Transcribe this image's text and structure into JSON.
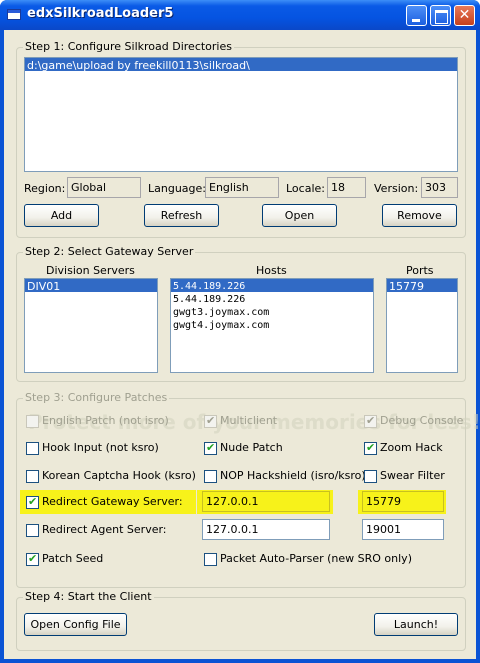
{
  "window": {
    "title": "edxSilkroadLoader5"
  },
  "step1": {
    "legend": "Step 1: Configure Silkroad Directories",
    "directories": [
      "d:\\game\\upload by freekill0113\\silkroad\\"
    ],
    "region_label": "Region:",
    "region_value": "Global",
    "language_label": "Language:",
    "language_value": "English",
    "locale_label": "Locale:",
    "locale_value": "18",
    "version_label": "Version:",
    "version_value": "303",
    "buttons": {
      "add": "Add",
      "refresh": "Refresh",
      "open": "Open",
      "remove": "Remove"
    }
  },
  "step2": {
    "legend": "Step 2: Select Gateway Server",
    "division_header": "Division Servers",
    "hosts_header": "Hosts",
    "ports_header": "Ports",
    "divisions": [
      "DIV01"
    ],
    "hosts": [
      "5.44.189.226",
      "5.44.189.226",
      "gwgt3.joymax.com",
      "gwgt4.joymax.com"
    ],
    "ports": [
      "15779"
    ]
  },
  "step3": {
    "legend": "Step 3: Configure Patches",
    "english_patch": "English Patch (not isro)",
    "multiclient": "Multiclient",
    "debug_console": "Debug Console",
    "hook_input": "Hook Input (not ksro)",
    "nude_patch": "Nude Patch",
    "zoom_hack": "Zoom Hack",
    "korean_captcha": "Korean Captcha Hook (ksro)",
    "nop_hackshield": "NOP Hackshield (isro/ksro)",
    "swear_filter": "Swear Filter",
    "redirect_gateway": "Redirect Gateway Server:",
    "gateway_ip": "127.0.0.1",
    "gateway_port": "15779",
    "redirect_agent": "Redirect Agent Server:",
    "agent_ip": "127.0.0.1",
    "agent_port": "19001",
    "patch_seed": "Patch Seed",
    "packet_parser": "Packet Auto-Parser (new SRO only)"
  },
  "step4": {
    "legend": "Step 4: Start the Client",
    "open_config": "Open Config File",
    "launch": "Launch!"
  },
  "watermark": "Protect more of your memories for less!"
}
